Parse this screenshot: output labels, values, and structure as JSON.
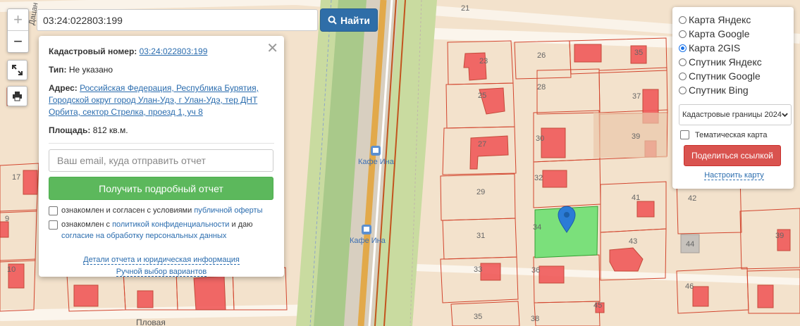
{
  "search": {
    "value": "03:24:022803:199",
    "button_label": "Найти"
  },
  "zoom": {
    "in_label": "+",
    "out_label": "−"
  },
  "card": {
    "cadastral_label": "Кадастровый номер:",
    "cadastral_value": "03:24:022803:199",
    "type_label": "Тип:",
    "type_value": "Не указано",
    "address_label": "Адрес:",
    "address_value": "Российская Федерация, Республика Бурятия, Городской округ город Улан-Удэ, г Улан-Удэ, тер ДНТ Орбита, сектор Стрелка, проезд 1, уч 8",
    "area_label": "Площадь:",
    "area_value": "812 кв.м.",
    "email_placeholder": "Ваш email, куда отправить отчет",
    "report_button": "Получить подробный отчет",
    "check1_text": "ознакомлен и согласен с условиями ",
    "check1_link": "публичной оферты",
    "check2_text": "ознакомлен с ",
    "check2_link": "политикой конфиденциальности",
    "check2_mid": " и даю ",
    "check2_link2": "согласие на обработку персональных данных",
    "details_link": "Детали отчета и юридическая информация",
    "manual_link": "Ручной выбор вариантов"
  },
  "layers": {
    "options": [
      {
        "label": "Карта Яндекс",
        "selected": false
      },
      {
        "label": "Карта Google",
        "selected": false
      },
      {
        "label": "Карта 2GIS",
        "selected": true
      },
      {
        "label": "Спутник Яндекс",
        "selected": false
      },
      {
        "label": "Спутник Google",
        "selected": false
      },
      {
        "label": "Спутник Bing",
        "selected": false
      }
    ],
    "boundary_select": "Кадастровые границы 2024",
    "thematic_label": "Тематическая карта",
    "share_button": "Поделиться ссылкой",
    "setup_link": "Настроить карту"
  },
  "map": {
    "street_left": "Дацан",
    "street_bottom": "Пловая",
    "poi": [
      "Кафе Ина",
      "Кафе Ина"
    ],
    "plots": [
      "21",
      "26",
      "35",
      "23",
      "25",
      "28",
      "37",
      "27",
      "30",
      "39",
      "29",
      "32",
      "41",
      "42",
      "31",
      "34",
      "44",
      "43",
      "39",
      "33",
      "36",
      "46",
      "35",
      "38",
      "45",
      "17",
      "9",
      "10"
    ]
  },
  "colors": {
    "accent": "#2f6ea8",
    "report": "#5cb85c",
    "share": "#d9534f",
    "highlight": "#7be07b",
    "boundary": "#d2452e"
  }
}
